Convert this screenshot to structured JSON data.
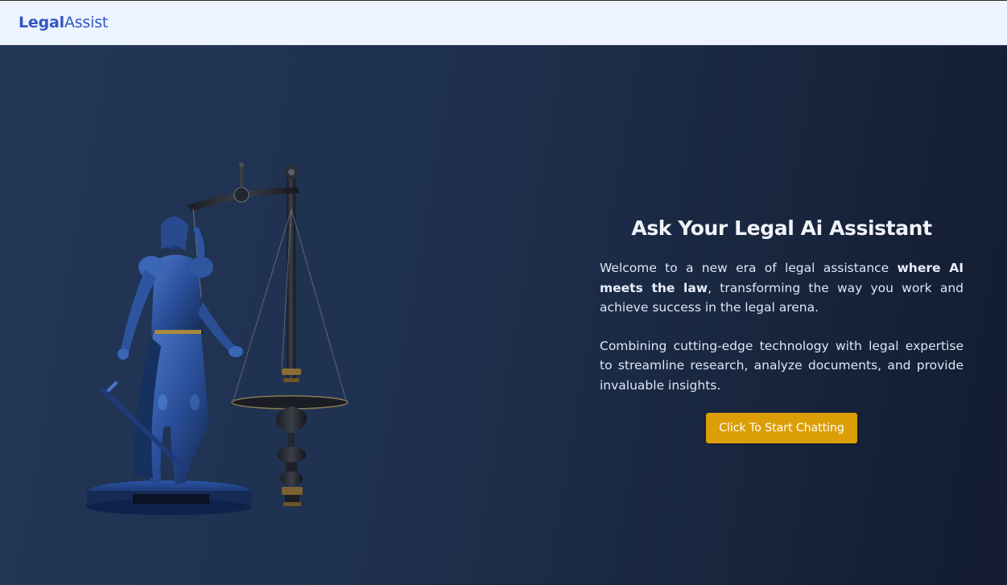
{
  "navbar": {
    "brand_part1": "Legal",
    "brand_part2": "Assist"
  },
  "hero": {
    "title": "Ask Your Legal Ai Assistant",
    "paragraph1_before": "Welcome to a new era of legal assistance ",
    "paragraph1_bold": "where AI meets the law",
    "paragraph1_after": ", transforming the way you work and achieve success in the legal arena.",
    "paragraph2": "Combining cutting-edge technology with legal expertise to streamline research, analyze documents, and provide invaluable insights.",
    "cta_label": "Click To Start Chatting",
    "illustration": "lady-justice-statue-with-scales"
  },
  "colors": {
    "navbar_bg": "#eef4ff",
    "brand": "#2f55c7",
    "hero_bg_start": "#223656",
    "hero_bg_end": "#131c30",
    "cta_bg": "#dc9e06"
  }
}
